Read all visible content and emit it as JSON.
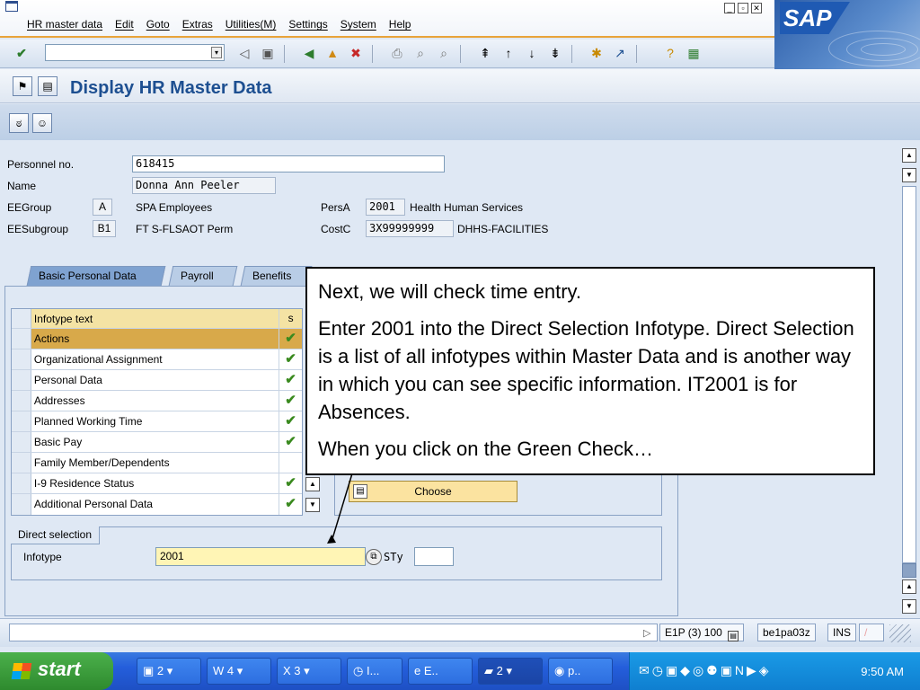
{
  "menu": [
    "HR master data",
    "Edit",
    "Goto",
    "Extras",
    "Utilities(M)",
    "Settings",
    "System",
    "Help"
  ],
  "brand": "SAP",
  "page_title": "Display HR Master Data",
  "header": {
    "personnel_no_label": "Personnel no.",
    "personnel_no": "618415",
    "name_label": "Name",
    "name": "Donna Ann Peeler",
    "eegroup_label": "EEGroup",
    "eegroup_code": "A",
    "eegroup_text": "SPA Employees",
    "eesubgroup_label": "EESubgroup",
    "eesubgroup_code": "B1",
    "eesubgroup_text": "FT S-FLSAOT Perm",
    "persa_label": "PersA",
    "persa_code": "2001",
    "persa_text": "Health Human Services",
    "costc_label": "CostC",
    "costc_code": "3X99999999",
    "costc_text": "DHHS-FACILITIES"
  },
  "tabs": [
    "Basic Personal Data",
    "Payroll",
    "Benefits"
  ],
  "infotype_table": {
    "col_text": "Infotype text",
    "col_status": "s",
    "rows": [
      {
        "text": "Actions",
        "status": "✔"
      },
      {
        "text": "Organizational Assignment",
        "status": "✔"
      },
      {
        "text": "Personal Data",
        "status": "✔"
      },
      {
        "text": "Addresses",
        "status": "✔"
      },
      {
        "text": "Planned Working Time",
        "status": "✔"
      },
      {
        "text": "Basic Pay",
        "status": "✔"
      },
      {
        "text": "Family Member/Dependents",
        "status": ""
      },
      {
        "text": "I-9 Residence Status",
        "status": "✔"
      },
      {
        "text": "Additional Personal Data",
        "status": "✔"
      }
    ]
  },
  "choose_button": "Choose",
  "direct_selection": {
    "title": "Direct selection",
    "infotype_label": "Infotype",
    "infotype_value": "2001",
    "sty_label": "STy",
    "sty_value": ""
  },
  "callout": {
    "p1": "Next, we will check time entry.",
    "p2": "Enter 2001 into the Direct Selection Infotype.  Direct Selection is a list of all infotypes within Master Data and is another way in which you can see specific information.  IT2001 is for Absences.",
    "p3": "When you click on the Green Check…"
  },
  "status": {
    "system": "E1P (3) 100",
    "server": "be1pa03z",
    "mode": "INS"
  },
  "taskbar": {
    "start": "start",
    "tasks": [
      "2",
      "4",
      "3",
      "I...",
      "E..",
      "2",
      "p.."
    ],
    "clock": "9:50 AM"
  },
  "colors": {
    "accent_orange": "#e8a33a",
    "sap_blue": "#1f5ab3",
    "check_green": "#3a8a1f",
    "selected_row": "#d8a94a",
    "input_yellow": "#fff5b5"
  }
}
